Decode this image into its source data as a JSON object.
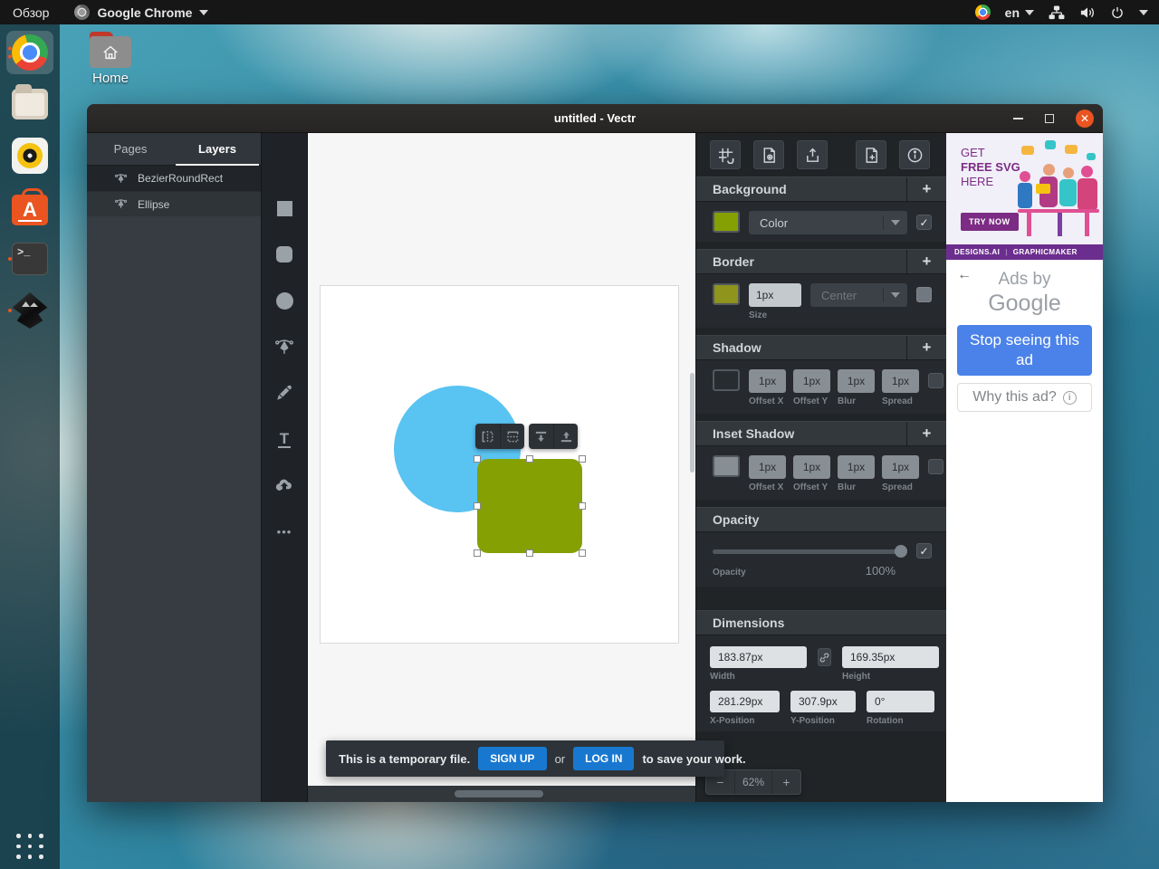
{
  "top_bar": {
    "activities": "Обзор",
    "app_name": "Google Chrome",
    "language": "en"
  },
  "desktop": {
    "home_label": "Home"
  },
  "dock": {
    "items": [
      "google-chrome",
      "files",
      "rhythmbox",
      "ubuntu-software",
      "terminal",
      "inkscape"
    ]
  },
  "icons": {
    "text_tool": "T",
    "more_tool": "•••",
    "terminal_prompt": ">_",
    "software_letter": "A",
    "back_arrow": "←",
    "info": "i",
    "close": "✕"
  },
  "window": {
    "title": "untitled - Vectr"
  },
  "layers_panel": {
    "tab_pages": "Pages",
    "tab_layers": "Layers",
    "layers": [
      {
        "name": "BezierRoundRect"
      },
      {
        "name": "Ellipse"
      }
    ]
  },
  "canvas": {
    "shape_blue": "#59c3f2",
    "shape_olive": "#85a003"
  },
  "panel": {
    "add_label": "+",
    "background": {
      "title": "Background",
      "type_value": "Color"
    },
    "border": {
      "title": "Border",
      "size_value": "1px",
      "size_label": "Size",
      "position_value": "Center"
    },
    "shadow": {
      "title": "Shadow",
      "fields": [
        {
          "value": "1px",
          "label": "Offset X"
        },
        {
          "value": "1px",
          "label": "Offset Y"
        },
        {
          "value": "1px",
          "label": "Blur"
        },
        {
          "value": "1px",
          "label": "Spread"
        }
      ]
    },
    "inset_shadow": {
      "title": "Inset Shadow",
      "fields": [
        {
          "value": "1px",
          "label": "Offset X"
        },
        {
          "value": "1px",
          "label": "Offset Y"
        },
        {
          "value": "1px",
          "label": "Blur"
        },
        {
          "value": "1px",
          "label": "Spread"
        }
      ]
    },
    "opacity": {
      "title": "Opacity",
      "label": "Opacity",
      "value": "100%"
    },
    "dimensions": {
      "title": "Dimensions",
      "width_value": "183.87px",
      "width_label": "Width",
      "height_value": "169.35px",
      "height_label": "Height",
      "x_value": "281.29px",
      "x_label": "X-Position",
      "y_value": "307.9px",
      "y_label": "Y-Position",
      "rotation_value": "0°",
      "rotation_label": "Rotation"
    },
    "zoom": {
      "minus": "−",
      "value": "62%",
      "plus": "+"
    }
  },
  "footer": {
    "prefix": "This is a temporary file.",
    "signup": "SIGN UP",
    "or": "or",
    "login": "LOG IN",
    "suffix": "to save your work."
  },
  "ad": {
    "line1": "GET",
    "line2": "FREE SVG",
    "line3": "HERE",
    "cta": "TRY NOW",
    "brand": "DESIGNS.AI",
    "sep": "|",
    "product": "GRAPHICMAKER",
    "ads_by": "Ads by",
    "google": "Google",
    "stop": "Stop seeing this ad",
    "why": "Why this ad?"
  }
}
